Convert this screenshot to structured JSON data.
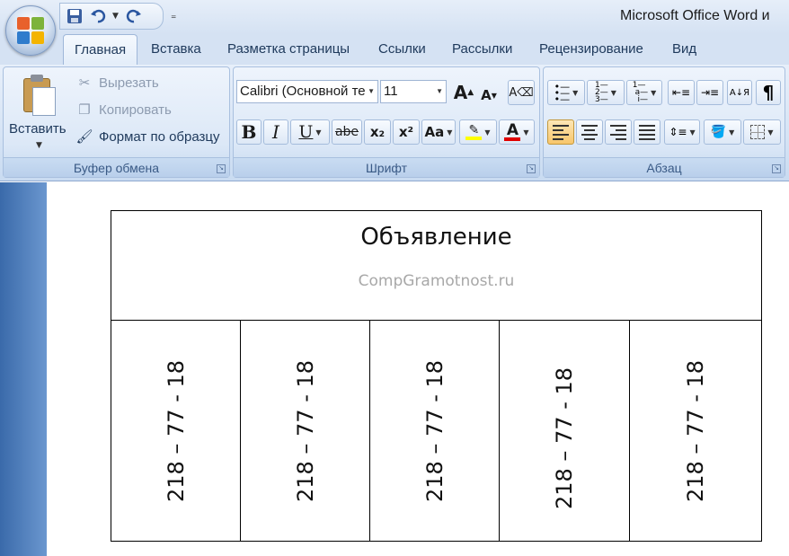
{
  "window": {
    "title": "Microsoft Office Word и"
  },
  "qat": {
    "items": [
      "save-icon",
      "undo-icon",
      "redo-icon"
    ]
  },
  "tabs": [
    {
      "label": "Главная",
      "active": true
    },
    {
      "label": "Вставка"
    },
    {
      "label": "Разметка страницы"
    },
    {
      "label": "Ссылки"
    },
    {
      "label": "Рассылки"
    },
    {
      "label": "Рецензирование"
    },
    {
      "label": "Вид"
    }
  ],
  "clipboard": {
    "paste_label": "Вставить",
    "cut_label": "Вырезать",
    "copy_label": "Копировать",
    "format_painter_label": "Формат по образцу",
    "group_label": "Буфер обмена"
  },
  "font": {
    "family": "Calibri (Основной те",
    "size": "11",
    "group_label": "Шрифт",
    "bold": "B",
    "italic": "I",
    "underline": "U",
    "strike": "abe",
    "subscript": "x₂",
    "superscript": "x²",
    "change_case": "Aa",
    "grow": "A",
    "shrink": "A"
  },
  "paragraph": {
    "group_label": "Абзац",
    "pilcrow": "¶",
    "sort": "А↓Я"
  },
  "document": {
    "title": "Объявление",
    "watermark": "CompGramotnost.ru",
    "phones": [
      "218 – 77 - 18",
      "218 – 77 - 18",
      "218 – 77 - 18",
      "218 – 77 - 18",
      "218 – 77 - 18"
    ]
  },
  "colors": {
    "highlight": "#ffff00",
    "font_color": "#e00000",
    "ribbon_text": "#1e395b"
  }
}
